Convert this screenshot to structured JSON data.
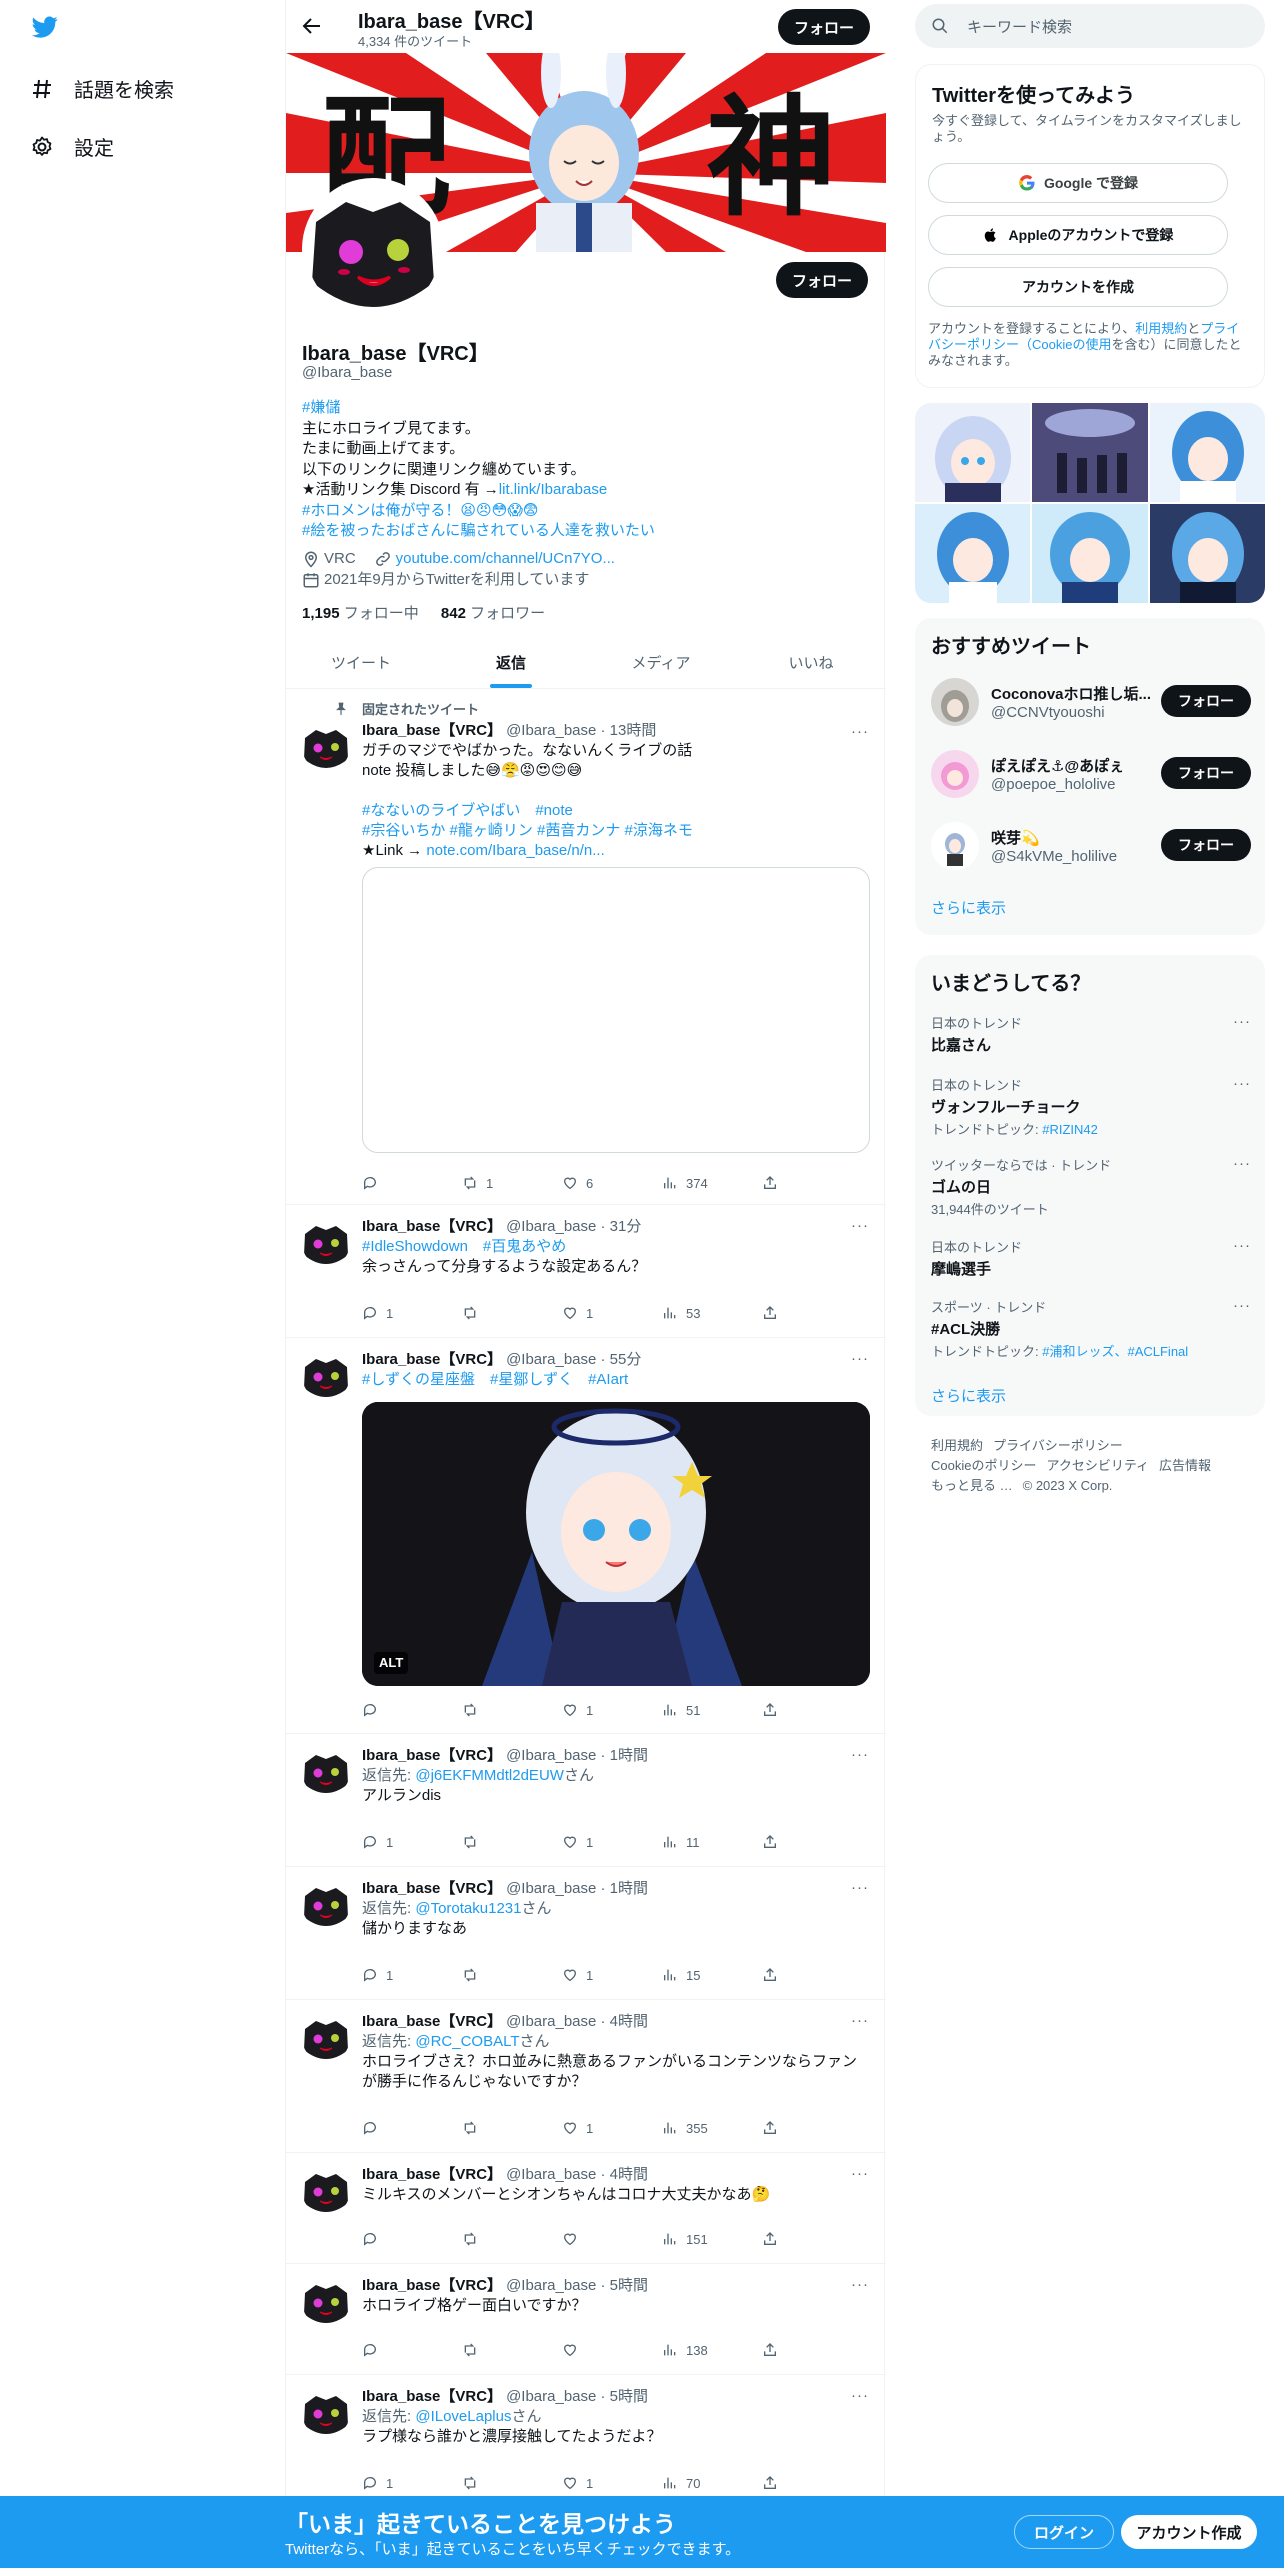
{
  "nav": {
    "items": [
      {
        "label": "話題を検索",
        "icon": "hashtag-icon"
      },
      {
        "label": "設定",
        "icon": "gear-icon"
      }
    ]
  },
  "profile_header": {
    "name": "Ibara_base【VRC】",
    "tweet_count": "4,334 件のツイート",
    "follow_label": "フォロー"
  },
  "banner": {
    "text_left": "配",
    "text_right": "神"
  },
  "profile": {
    "name": "Ibara_base【VRC】",
    "handle": "@Ibara_base",
    "follow_label": "フォロー",
    "bio": {
      "line1": "#嫌儲",
      "line2": "主にホロライブ見てます。",
      "line3": "たまに動画上げてます。",
      "line4": "以下のリンクに関連リンク纏めています。",
      "line5_prefix": "★活動リンク集 Discord 有 →",
      "line5_link": "lit.link/Ibarabase",
      "line6": "#ホロメンは俺が守る！😫😠😳😱😨",
      "line7": "#絵を被ったおばさんに騙されている人達を救いたい"
    },
    "location": "VRC",
    "url": "youtube.com/channel/UCn7YO...",
    "joined": "2021年9月からTwitterを利用しています",
    "following_count": "1,195",
    "following_label": "フォロー中",
    "followers_count": "842",
    "followers_label": "フォロワー"
  },
  "tabs": [
    {
      "label": "ツイート",
      "active": false
    },
    {
      "label": "返信",
      "active": true
    },
    {
      "label": "メディア",
      "active": false
    },
    {
      "label": "いいね",
      "active": false
    }
  ],
  "pinned_label": "固定されたツイート",
  "tweets": [
    {
      "name": "Ibara_base【VRC】",
      "handle": "@Ibara_base · 13時間",
      "line1": "ガチのマジでやばかった。なないんくライブの話",
      "line2": "note 投稿しました😅😤😡😍😊😅",
      "line3": "#なないのライブやばい　#note",
      "line4": "#宗谷いちか #龍ヶ崎リン #茜音カンナ #涼海ネモ",
      "line5_prefix": "★Link → ",
      "line5_link": "note.com/Ibara_base/n/n...",
      "replies": "",
      "retweets": "1",
      "likes": "6",
      "views": "374"
    },
    {
      "name": "Ibara_base【VRC】",
      "handle": "@Ibara_base · 31分",
      "line1": "#IdleShowdown　#百鬼あやめ",
      "line2": "余っさんって分身するような設定あるん？",
      "replies": "1",
      "retweets": "",
      "likes": "1",
      "views": "53"
    },
    {
      "name": "Ibara_base【VRC】",
      "handle": "@Ibara_base · 55分",
      "line1": "#しずくの星座盤　#星鄒しずく　#AIart",
      "alt": "ALT",
      "replies": "",
      "retweets": "",
      "likes": "1",
      "views": "51"
    },
    {
      "name": "Ibara_base【VRC】",
      "handle": "@Ibara_base · 1時間",
      "reply_prefix": "返信先: ",
      "reply_to": "@j6EKFMMdtl2dEUW",
      "reply_suffix": "さん",
      "line1": "アルランdis",
      "replies": "1",
      "retweets": "",
      "likes": "1",
      "views": "11"
    },
    {
      "name": "Ibara_base【VRC】",
      "handle": "@Ibara_base · 1時間",
      "reply_prefix": "返信先: ",
      "reply_to": "@Torotaku1231",
      "reply_suffix": "さん",
      "line1": "儲かりますなあ",
      "replies": "1",
      "retweets": "",
      "likes": "1",
      "views": "15"
    },
    {
      "name": "Ibara_base【VRC】",
      "handle": "@Ibara_base · 4時間",
      "reply_prefix": "返信先: ",
      "reply_to": "@RC_COBALT",
      "reply_suffix": "さん",
      "line1": "ホロライブさえ？ホロ並みに熱意あるファンがいるコンテンツならファン",
      "line2": "が勝手に作るんじゃないですか？",
      "replies": "",
      "retweets": "",
      "likes": "1",
      "views": "355"
    },
    {
      "name": "Ibara_base【VRC】",
      "handle": "@Ibara_base · 4時間",
      "line1": "ミルキスのメンバーとシオンちゃんはコロナ大丈夫かなあ🤔",
      "replies": "",
      "retweets": "",
      "likes": "",
      "views": "151"
    },
    {
      "name": "Ibara_base【VRC】",
      "handle": "@Ibara_base · 5時間",
      "line1": "ホロライブ格ゲー面白いですか？",
      "replies": "",
      "retweets": "",
      "likes": "",
      "views": "138"
    },
    {
      "name": "Ibara_base【VRC】",
      "handle": "@Ibara_base · 5時間",
      "reply_prefix": "返信先: ",
      "reply_to": "@ILoveLaplus",
      "reply_suffix": "さん",
      "line1": "ラプ様なら誰かと濃厚接触してたようだよ？",
      "replies": "1",
      "retweets": "",
      "likes": "1",
      "views": "70"
    }
  ],
  "sidebar": {
    "search_placeholder": "キーワード検索",
    "signup": {
      "title": "Twitterを使ってみよう",
      "subtitle": "今すぐ登録して、タイムラインをカスタマイズしましょう。",
      "google": "Google で登録",
      "apple": "Appleのアカウントで登録",
      "create": "アカウントを作成",
      "terms_1": "アカウントを登録することにより、",
      "terms_link1": "利用規約",
      "terms_2": "と",
      "terms_link2": "プライバシーポリシー（Cookieの使用",
      "terms_3": "を含む）に同意したとみなされます。"
    },
    "recommend": {
      "title": "おすすめツイート",
      "accounts": [
        {
          "name": "Coconovaホロ推し垢...",
          "handle": "@CCNVtyouoshi",
          "follow": "フォロー"
        },
        {
          "name": "ぽえぽえ⚓@あぽぇ",
          "handle": "@poepoe_hololive",
          "follow": "フォロー"
        },
        {
          "name": "咲芽💫",
          "handle": "@S4kVMe_holilive",
          "follow": "フォロー"
        }
      ],
      "more": "さらに表示"
    },
    "trends": {
      "title": "いまどうしてる？",
      "items": [
        {
          "context": "日本のトレンド",
          "title": "比嘉さん",
          "sub": ""
        },
        {
          "context": "日本のトレンド",
          "title": "ヴォンフルーチョーク",
          "sub_prefix": "トレンドトピック: ",
          "sub_link": "#RIZIN42"
        },
        {
          "context": "ツイッターならでは · トレンド",
          "title": "ゴムの日",
          "sub": "31,944件のツイート"
        },
        {
          "context": "日本のトレンド",
          "title": "摩嶋選手",
          "sub": ""
        },
        {
          "context": "スポーツ · トレンド",
          "title": "#ACL決勝",
          "sub_prefix": "トレンドトピック: ",
          "sub_link": "#浦和レッズ、#ACLFinal"
        }
      ],
      "more": "さらに表示"
    },
    "footer": {
      "l1": "利用規約",
      "l2": "プライバシーポリシー",
      "l3": "Cookieのポリシー",
      "l4": "アクセシビリティ",
      "l5": "広告情報",
      "l6": "もっと見る …",
      "l7": "© 2023 X Corp."
    }
  },
  "bottom_bar": {
    "title": "「いま」起きていることを見つけよう",
    "subtitle": "Twitterなら、「いま」起きていることをいち早くチェックできます。",
    "login": "ログイン",
    "signup": "アカウント作成"
  },
  "colors": {
    "accent": "#1d9bf0",
    "text": "#0f1419",
    "muted": "#536471",
    "button_dark": "#0f1419"
  }
}
